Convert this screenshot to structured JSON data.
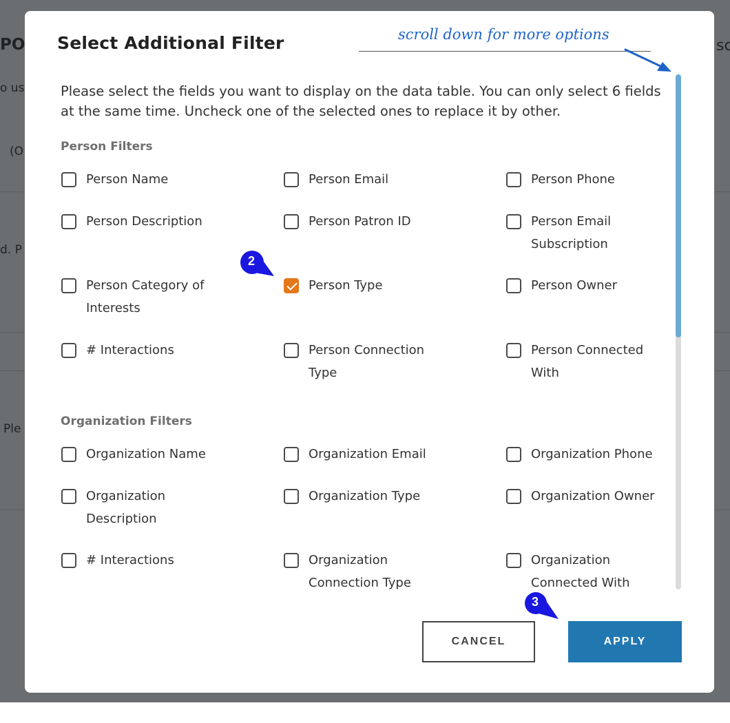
{
  "background": {
    "fragments": [
      "PO",
      "sc",
      "o us",
      "(O",
      "d. P",
      "Ple"
    ]
  },
  "modal": {
    "title": "Select Additional Filter",
    "description": "Please select the fields you want to display on the data table. You can only select 6 fields at the same time. Uncheck one of the selected ones to replace it by other.",
    "person_section_title": "Person Filters",
    "person_options": [
      {
        "label": "Person Name",
        "checked": false
      },
      {
        "label": "Person Email",
        "checked": false
      },
      {
        "label": "Person Phone",
        "checked": false
      },
      {
        "label": "Person Description",
        "checked": false
      },
      {
        "label": "Person Patron ID",
        "checked": false
      },
      {
        "label": "Person Email Subscription",
        "checked": false
      },
      {
        "label": "Person Category of Interests",
        "checked": false
      },
      {
        "label": "Person Type",
        "checked": true
      },
      {
        "label": "Person Owner",
        "checked": false
      },
      {
        "label": "# Interactions",
        "checked": false
      },
      {
        "label": "Person Connection Type",
        "checked": false
      },
      {
        "label": "Person Connected With",
        "checked": false
      }
    ],
    "org_section_title": "Organization Filters",
    "org_options": [
      {
        "label": "Organization Name",
        "checked": false
      },
      {
        "label": "Organization Email",
        "checked": false
      },
      {
        "label": "Organization Phone",
        "checked": false
      },
      {
        "label": "Organization Description",
        "checked": false
      },
      {
        "label": "Organization Type",
        "checked": false
      },
      {
        "label": "Organization Owner",
        "checked": false
      },
      {
        "label": "# Interactions",
        "checked": false
      },
      {
        "label": "Organization Connection Type",
        "checked": false
      },
      {
        "label": "Organization Connected With",
        "checked": false
      }
    ],
    "cancel_label": "CANCEL",
    "apply_label": "APPLY"
  },
  "annotations": {
    "scroll_hint": "scroll down for more options",
    "step_2": "2",
    "step_3": "3"
  },
  "colors": {
    "checked_accent": "#e4771a",
    "apply_button": "#2178b1",
    "scroll_thumb": "#6baad6",
    "badge": "#1a17e0",
    "annotation": "#1e64c8"
  }
}
